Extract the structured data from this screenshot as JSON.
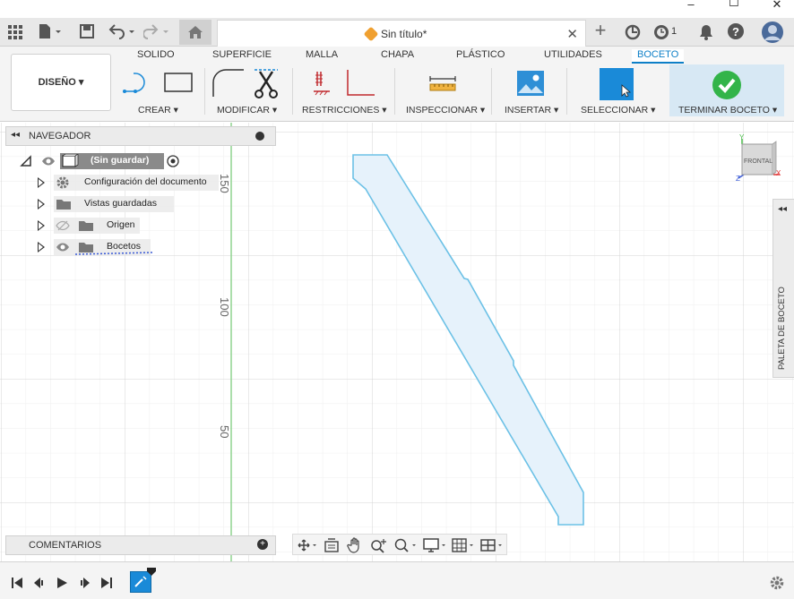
{
  "window": {
    "minimize_glyph": "–",
    "maximize_glyph": "☐",
    "close_glyph": "✕"
  },
  "appbar": {
    "document_title": "Sin título*",
    "jobs_count": "1",
    "icons": [
      "grid-icon",
      "file-icon",
      "save-icon",
      "undo-icon",
      "redo-icon",
      "home-icon",
      "plus-icon",
      "refresh-icon",
      "clock-icon",
      "bell-icon",
      "help-icon",
      "avatar"
    ]
  },
  "ribbon": {
    "tabs": [
      "SOLIDO",
      "SUPERFICIE",
      "MALLA",
      "CHAPA",
      "PLÁSTICO",
      "UTILIDADES",
      "BOCETO"
    ],
    "active_tab": "BOCETO",
    "workspace_button": "DISEÑO ▾",
    "groups": {
      "create": "CREAR ▾",
      "modify": "MODIFICAR ▾",
      "constraints": "RESTRICCIONES ▾",
      "inspect": "INSPECCIONAR ▾",
      "insert": "INSERTAR ▾",
      "select": "SELECCIONAR ▾",
      "finish": "TERMINAR BOCETO ▾"
    },
    "accent_color": "#0d7fc7",
    "finish_color": "#33b449"
  },
  "navigator": {
    "title": "NAVEGADOR",
    "root": "(Sin guardar)",
    "items": [
      {
        "label": "Configuración del documento",
        "icon": "gear-icon"
      },
      {
        "label": "Vistas guardadas",
        "icon": "folder-icon"
      },
      {
        "label": "Origen",
        "icon": "folder-icon"
      },
      {
        "label": "Bocetos",
        "icon": "folder-icon"
      }
    ]
  },
  "canvas": {
    "ruler_labels": [
      "150",
      "100",
      "50"
    ],
    "viewcube_label": "FRONTAL",
    "axis_labels": [
      "Y",
      "X",
      "Z"
    ]
  },
  "palette": {
    "label": "PALETA DE BOCETO"
  },
  "comments": {
    "label": "COMENTARIOS"
  }
}
